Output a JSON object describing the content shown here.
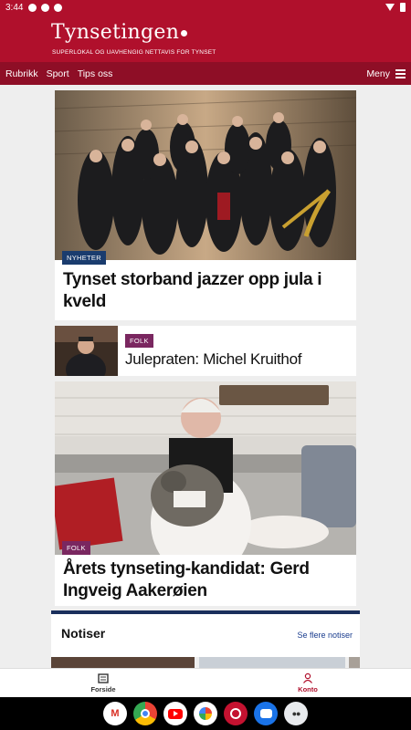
{
  "status_bar": {
    "time": "3:44"
  },
  "masthead": {
    "title": "Tynsetingen",
    "tagline": "SUPERLOKAL OG UAVHENGIG NETTAVIS FOR TYNSET"
  },
  "nav": {
    "links": [
      "Rubrikk",
      "Sport",
      "Tips oss"
    ],
    "menu_label": "Meny"
  },
  "articles": [
    {
      "category": "NYHETER",
      "headline_lines": [
        "Tynset storband jazzer opp jula i",
        "kveld"
      ]
    },
    {
      "category": "FOLK",
      "headline": "Julepraten: Michel Kruithof"
    },
    {
      "category": "FOLK",
      "headline_lines": [
        "Årets tynseting-kandidat: Gerd",
        "Ingveig Aakerøien"
      ]
    }
  ],
  "notiser": {
    "title": "Notiser",
    "link": "Se flere notiser"
  },
  "bottom_nav": {
    "home": "Forside",
    "account": "Konto"
  },
  "colors": {
    "brand_red": "#b0102c",
    "nav_red": "#8e0e26",
    "nyheter_label": "#1a3c6e",
    "folk_label": "#7a2760",
    "account_active": "#b0102c"
  },
  "dock_apps": [
    "gmail-icon",
    "chrome-icon",
    "youtube-icon",
    "photos-icon",
    "podcast-app-icon",
    "messages-icon",
    "app-drawer-icon"
  ]
}
